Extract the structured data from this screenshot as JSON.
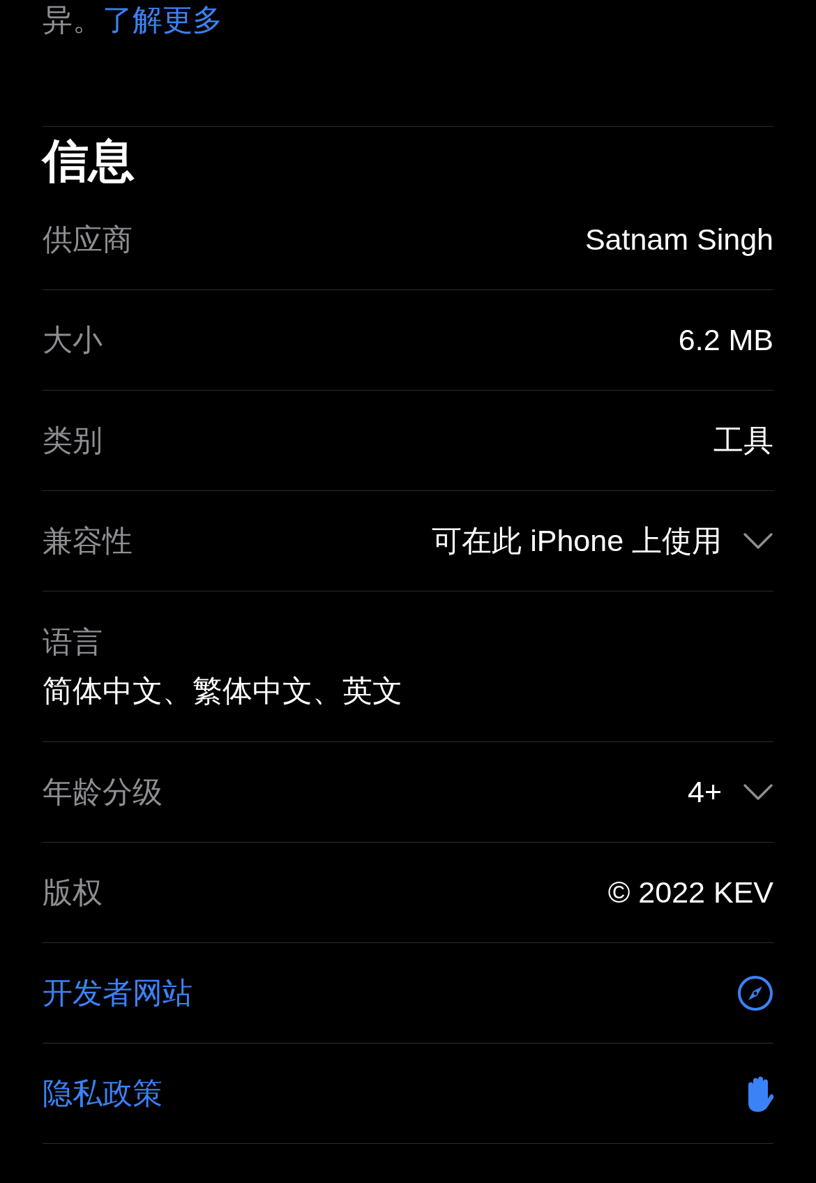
{
  "description_tail": {
    "text": "异。",
    "link": "了解更多"
  },
  "info": {
    "title": "信息",
    "rows": [
      {
        "kind": "value",
        "label": "供应商",
        "value": "Satnam Singh"
      },
      {
        "kind": "value",
        "label": "大小",
        "value": "6.2 MB"
      },
      {
        "kind": "value",
        "label": "类别",
        "value": "工具"
      },
      {
        "kind": "expandable",
        "label": "兼容性",
        "value": "可在此 iPhone 上使用",
        "expanded": false
      },
      {
        "kind": "stacked",
        "label": "语言",
        "value": "简体中文、繁体中文、英文"
      },
      {
        "kind": "expandable",
        "label": "年龄分级",
        "value": "4+",
        "expanded": false
      },
      {
        "kind": "value",
        "label": "版权",
        "value": "© 2022 KEV"
      }
    ],
    "links": [
      {
        "kind": "compass",
        "label": "开发者网站"
      },
      {
        "kind": "hand",
        "label": "隐私政策"
      }
    ]
  }
}
